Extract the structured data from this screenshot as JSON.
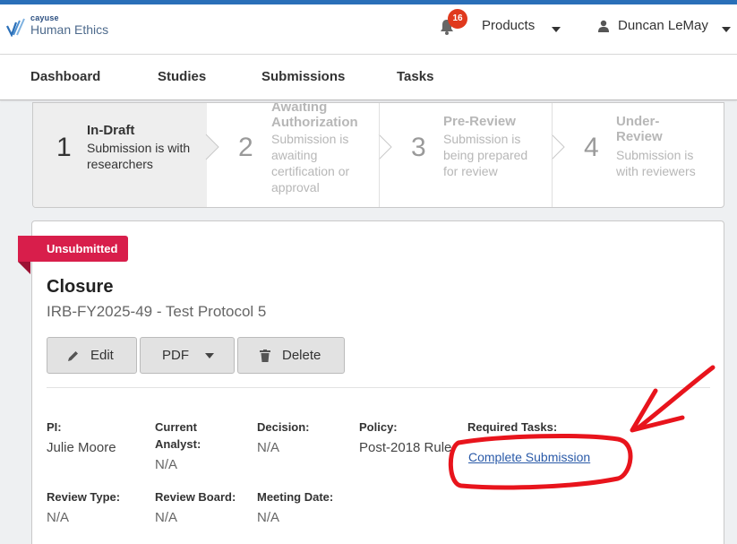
{
  "app": {
    "logo_small": "cayuse",
    "logo_name": "Human Ethics",
    "notification_count": "16",
    "products_label": "Products",
    "user_name": "Duncan LeMay"
  },
  "nav": {
    "items": [
      {
        "label": "Dashboard"
      },
      {
        "label": "Studies"
      },
      {
        "label": "Submissions"
      },
      {
        "label": "Tasks"
      }
    ]
  },
  "steps": [
    {
      "number": "1",
      "title": "In-Draft",
      "desc": "Submission is with researchers"
    },
    {
      "number": "2",
      "title": "Awaiting Authorization",
      "desc": "Submission is awaiting certification or approval"
    },
    {
      "number": "3",
      "title": "Pre-Review",
      "desc": "Submission is being prepared for review"
    },
    {
      "number": "4",
      "title": "Under-Review",
      "desc": "Submission is with reviewers"
    }
  ],
  "submission": {
    "status": "Unsubmitted",
    "title": "Closure",
    "id_line": "IRB-FY2025-49 - Test Protocol 5",
    "buttons": {
      "edit": "Edit",
      "pdf": "PDF",
      "delete": "Delete"
    },
    "fields": {
      "pi": {
        "label": "PI:",
        "value": "Julie Moore"
      },
      "analyst": {
        "label": "Current Analyst:",
        "value": "N/A"
      },
      "decision": {
        "label": "Decision:",
        "value": "N/A"
      },
      "policy": {
        "label": "Policy:",
        "value": "Post-2018 Rule"
      },
      "required_tasks": {
        "label": "Required Tasks:",
        "value": "Complete Submission"
      },
      "review_type": {
        "label": "Review Type:",
        "value": "N/A"
      },
      "review_board": {
        "label": "Review Board:",
        "value": "N/A"
      },
      "meeting_date": {
        "label": "Meeting Date:",
        "value": "N/A"
      }
    }
  },
  "colors": {
    "brand_blue": "#2a6fb8",
    "badge_red": "#e0391d",
    "ribbon_red": "#d81e4b",
    "annotation_red": "#e8141c",
    "link_blue": "#2a5aa8"
  }
}
